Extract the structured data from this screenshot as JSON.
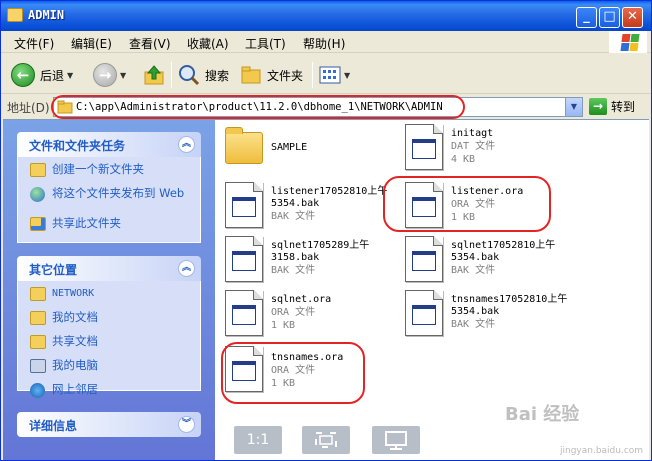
{
  "window": {
    "title": "ADMIN"
  },
  "menu": [
    "文件(F)",
    "编辑(E)",
    "查看(V)",
    "收藏(A)",
    "工具(T)",
    "帮助(H)"
  ],
  "toolbar": {
    "back": "后退",
    "search": "搜索",
    "folders": "文件夹"
  },
  "address": {
    "label": "地址(D)",
    "path": "C:\\app\\Administrator\\product\\11.2.0\\dbhome_1\\NETWORK\\ADMIN",
    "go": "转到"
  },
  "tasks_panel": {
    "title": "文件和文件夹任务",
    "items": [
      "创建一个新文件夹",
      "将这个文件夹发布到 Web",
      "共享此文件夹"
    ]
  },
  "places_panel": {
    "title": "其它位置",
    "items": [
      "NETWORK",
      "我的文档",
      "共享文档",
      "我的电脑",
      "网上邻居"
    ]
  },
  "details_panel": {
    "title": "详细信息"
  },
  "files": [
    {
      "name": "SAMPLE",
      "type": "",
      "size": ""
    },
    {
      "name": "initagt",
      "type": "DAT 文件",
      "size": "4 KB"
    },
    {
      "name": "listener17052810上午5354.bak",
      "type": "BAK 文件",
      "size": ""
    },
    {
      "name": "listener.ora",
      "type": "ORA 文件",
      "size": "1 KB"
    },
    {
      "name": "sqlnet1705289上午3158.bak",
      "type": "BAK 文件",
      "size": ""
    },
    {
      "name": "sqlnet17052810上午5354.bak",
      "type": "BAK 文件",
      "size": ""
    },
    {
      "name": "sqlnet.ora",
      "type": "ORA 文件",
      "size": "1 KB"
    },
    {
      "name": "tnsnames17052810上午5354.bak",
      "type": "BAK 文件",
      "size": ""
    },
    {
      "name": "tnsnames.ora",
      "type": "ORA 文件",
      "size": "1 KB"
    }
  ],
  "viewer": {
    "one_to_one": "1:1"
  },
  "watermark": {
    "brand": "Bai 经验",
    "url": "jingyan.baidu.com"
  }
}
